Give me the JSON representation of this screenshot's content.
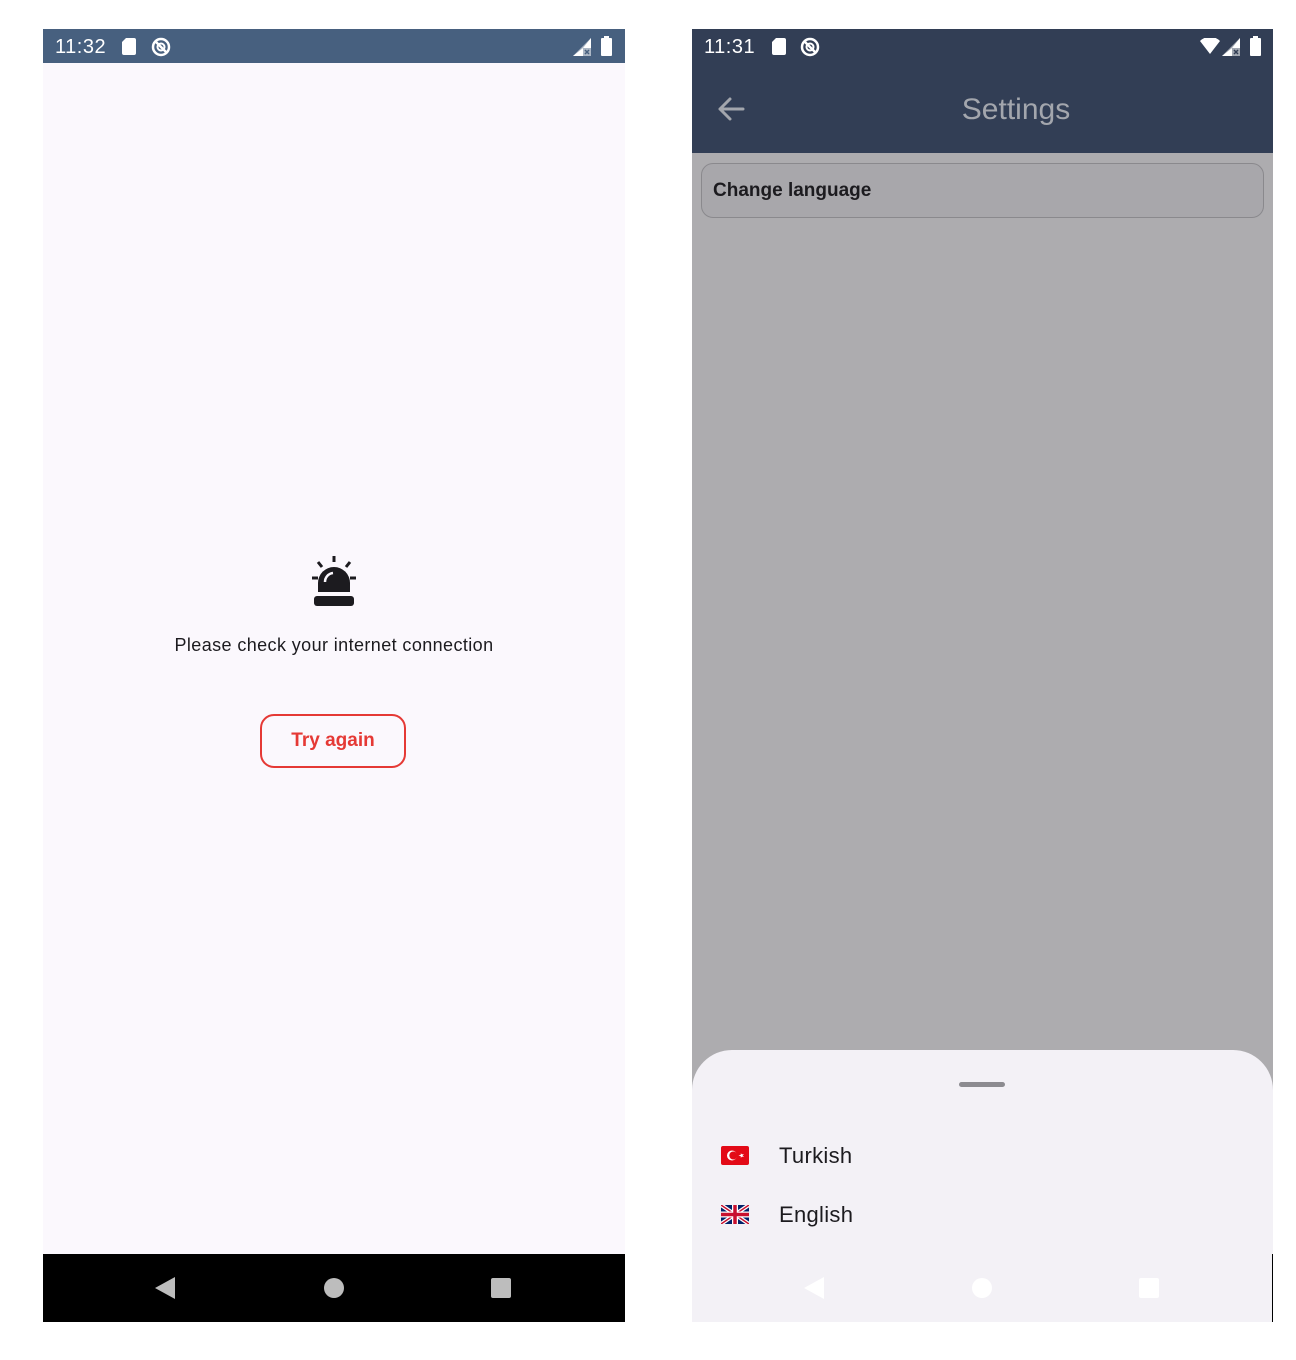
{
  "left_screen": {
    "status_time": "11:32",
    "message": "Please check your internet connection",
    "try_again_label": "Try again",
    "accent_color": "#e53935",
    "icons": [
      "sd-card-icon",
      "do-not-disturb-icon",
      "signal-icon",
      "battery-icon",
      "alarm-light-icon",
      "nav-back-icon",
      "nav-home-icon",
      "nav-recents-icon"
    ]
  },
  "right_screen": {
    "status_time": "11:31",
    "appbar_title": "Settings",
    "change_language_label": "Change language",
    "languages": [
      {
        "label": "Turkish",
        "flag": "turkey-flag-icon"
      },
      {
        "label": "English",
        "flag": "uk-flag-icon"
      }
    ],
    "appbar_color": "#323e55",
    "icons": [
      "sd-card-icon",
      "do-not-disturb-icon",
      "wifi-icon",
      "signal-icon",
      "battery-icon",
      "back-arrow-icon"
    ]
  }
}
